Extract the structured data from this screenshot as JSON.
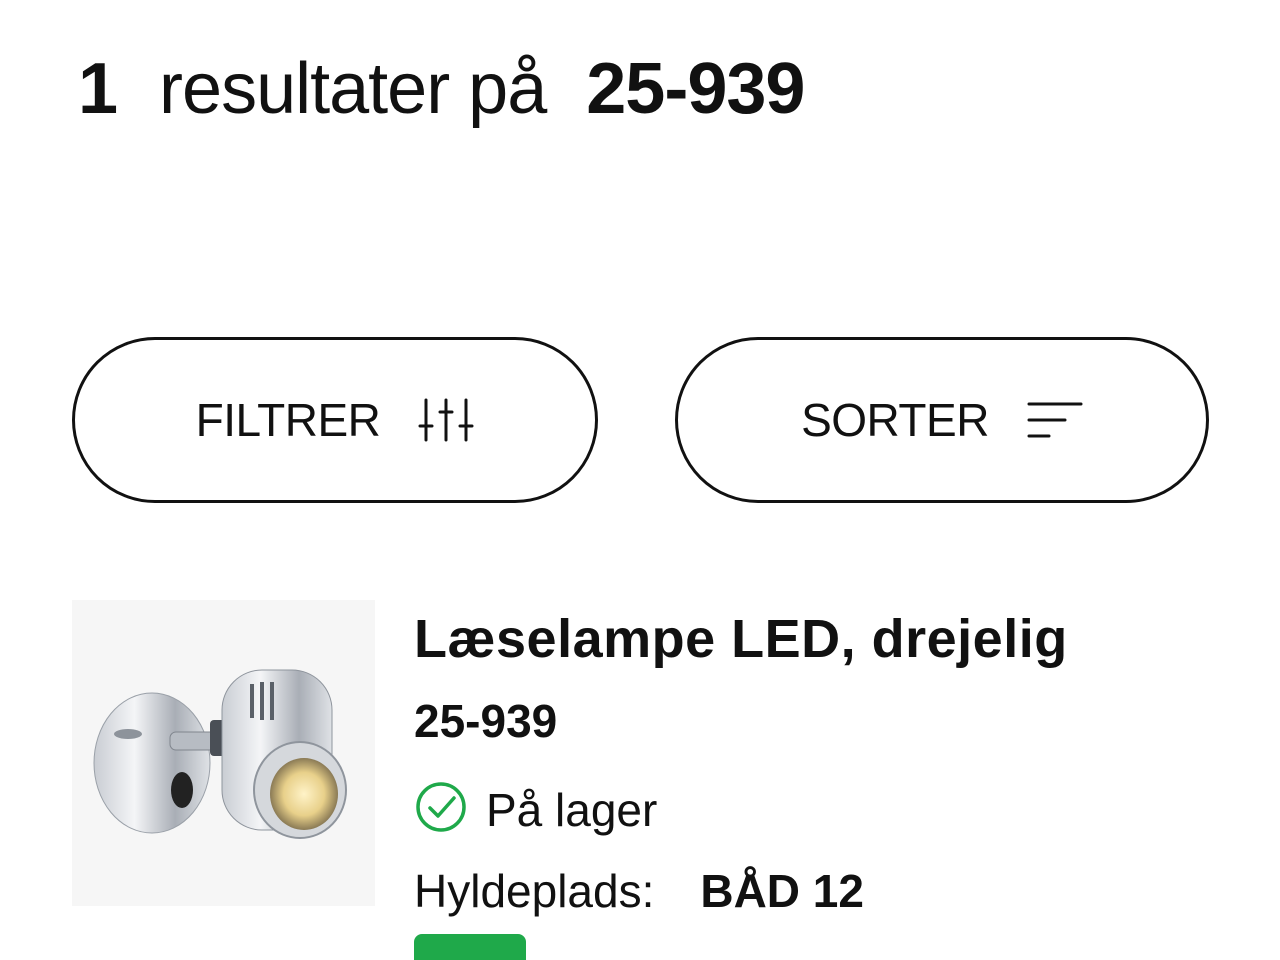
{
  "results": {
    "count": "1",
    "label": "resultater på",
    "query": "25-939"
  },
  "toolbar": {
    "filter_label": "FILTRER",
    "filter_icon": "sliders-icon",
    "sort_label": "SORTER",
    "sort_icon": "sort-lines-icon"
  },
  "product": {
    "title": "Læselampe LED, drejelig",
    "sku": "25-939",
    "stock_icon": "check-circle-icon",
    "stock_text": "På lager",
    "shelf_label": "Hyldeplads:",
    "shelf_value": "BÅD 12",
    "image_alt": "Læselampe LED, drejelig"
  },
  "colors": {
    "accent_green": "#1fa94a",
    "text": "#111111"
  }
}
